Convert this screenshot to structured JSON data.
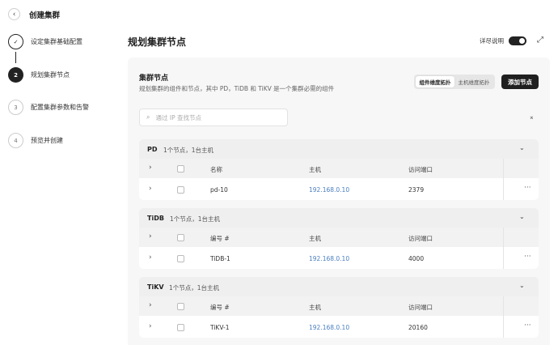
{
  "header": {
    "back_icon": "chevron-left-icon",
    "title": "创建集群"
  },
  "steps": [
    {
      "index": "✓",
      "label": "设定集群基础配置",
      "state": "done"
    },
    {
      "index": "2",
      "label": "规划集群节点",
      "state": "active"
    },
    {
      "index": "3",
      "label": "配置集群参数和告警",
      "state": "todo"
    },
    {
      "index": "4",
      "label": "预览并创建",
      "state": "todo"
    }
  ],
  "main": {
    "title": "规划集群节点",
    "detail_label": "详尽说明",
    "detail_on": true,
    "panel": {
      "title": "集群节点",
      "desc": "规划集群的组件和节点，其中 PD，TiDB 和 TiKV 是一个集群必需的组件",
      "views": [
        "组件维度拓扑",
        "主机维度拓扑"
      ],
      "active_view": "组件维度拓扑",
      "add_label": "添加节点",
      "search_placeholder": "通过 IP 查找节点",
      "groups": [
        {
          "name": "PD",
          "summary": "1个节点，1台主机",
          "cols": [
            "名称",
            "主机",
            "访问端口"
          ],
          "rows": [
            {
              "name": "pd-10",
              "host": "192.168.0.10",
              "port": "2379",
              "more": "···"
            }
          ]
        },
        {
          "name": "TiDB",
          "summary": "1个节点，1台主机",
          "cols": [
            "编号 #",
            "主机",
            "访问端口"
          ],
          "rows": [
            {
              "name": "TiDB-1",
              "host": "192.168.0.10",
              "port": "4000",
              "more": "···"
            }
          ]
        },
        {
          "name": "TiKV",
          "summary": "1个节点，1台主机",
          "cols": [
            "编号 #",
            "主机",
            "访问端口"
          ],
          "rows": [
            {
              "name": "TiKV-1",
              "host": "192.168.0.10",
              "port": "20160",
              "more": "···"
            }
          ]
        }
      ]
    }
  },
  "colors": {
    "accent": "#1f1f1f",
    "link": "#4a7fc1",
    "panel_bg": "#f7f7f7"
  }
}
